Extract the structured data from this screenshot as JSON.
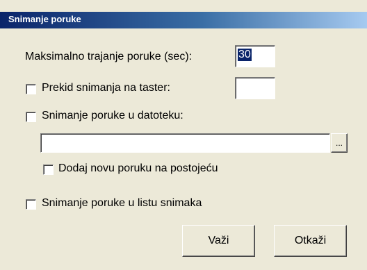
{
  "window": {
    "title": "Snimanje poruke"
  },
  "form": {
    "max_duration_label": "Maksimalno trajanje poruke (sec):",
    "max_duration_value": "30",
    "interrupt_label": "Prekid snimanja na taster:",
    "interrupt_checked": false,
    "interrupt_key_value": "",
    "save_to_file_label": "Snimanje poruke u datoteku:",
    "save_to_file_checked": false,
    "file_path_value": "",
    "browse_label": "...",
    "append_label": "Dodaj novu poruku na postojeću",
    "append_checked": false,
    "save_to_list_label": "Snimanje poruke u listu snimaka",
    "save_to_list_checked": false
  },
  "buttons": {
    "ok_label": "Važi",
    "cancel_label": "Otkaži"
  },
  "colors": {
    "dialog_bg": "#ece9d8",
    "title_start": "#0a246a",
    "title_end": "#a6caf0",
    "selection": "#0a246a"
  }
}
